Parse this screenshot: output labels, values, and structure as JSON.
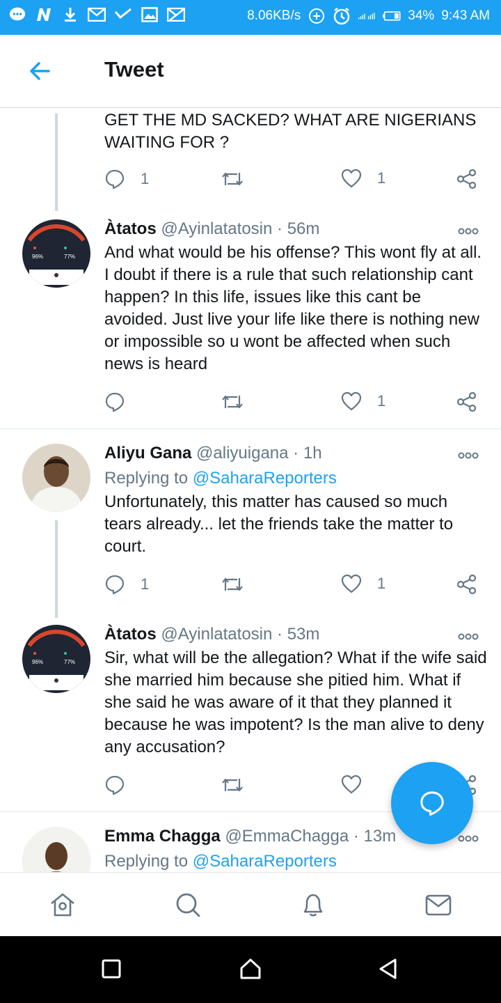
{
  "status_bar": {
    "network_speed": "8.06KB/s",
    "battery": "34%",
    "time": "9:43 AM"
  },
  "header": {
    "title": "Tweet"
  },
  "tweets": [
    {
      "body": "GET THE MD SACKED? WHAT ARE NIGERIANS WAITING FOR ?",
      "reply_count": "1",
      "retweet_count": "",
      "like_count": "1"
    },
    {
      "name": "Àtatos",
      "handle": "@Ayinlatatosin",
      "separator": "·",
      "time": "56m",
      "body": "And what would be his offense? This wont fly at all. I  doubt if there is a rule that such relationship cant happen? In this life, issues like this cant be avoided. Just live your life like there is nothing new or impossible so u wont be affected when such news is heard",
      "reply_count": "",
      "retweet_count": "",
      "like_count": "1"
    },
    {
      "name": "Aliyu Gana",
      "handle": "@aliyuigana",
      "separator": "·",
      "time": "1h",
      "replying_label": "Replying to",
      "replying_handle": "@SaharaReporters",
      "body": "Unfortunately, this matter has caused so much tears already... let the friends take the matter to court.",
      "reply_count": "1",
      "retweet_count": "",
      "like_count": "1"
    },
    {
      "name": "Àtatos",
      "handle": "@Ayinlatatosin",
      "separator": "·",
      "time": "53m",
      "body": "Sir, what will be the allegation? What if the wife said she married him because she pitied him. What if she said he was aware of it that they planned it because he was impotent? Is the man alive to deny any accusation?",
      "reply_count": "",
      "retweet_count": "",
      "like_count": ""
    },
    {
      "name": "Emma Chagga",
      "handle": "@EmmaChagga",
      "separator": "·",
      "time": "13m",
      "replying_label": "Replying to",
      "replying_handle": "@SaharaReporters"
    }
  ],
  "avatar_text": {
    "storage_pct": "96%",
    "ram_pct": "77%"
  },
  "colors": {
    "brand_blue": "#1da1f2",
    "text_primary": "#14171a",
    "text_secondary": "#657786",
    "divider": "#e1e8ed"
  },
  "icons": {
    "back": "arrow-left-icon",
    "reply": "comment-icon",
    "retweet": "retweet-icon",
    "like": "heart-icon",
    "share": "share-icon",
    "more": "more-dots-icon",
    "compose": "compose-reply-icon",
    "nav": [
      "home-icon",
      "search-icon",
      "notifications-icon",
      "messages-icon"
    ],
    "system": [
      "recents-icon",
      "home-button-icon",
      "back-triangle-icon"
    ]
  }
}
